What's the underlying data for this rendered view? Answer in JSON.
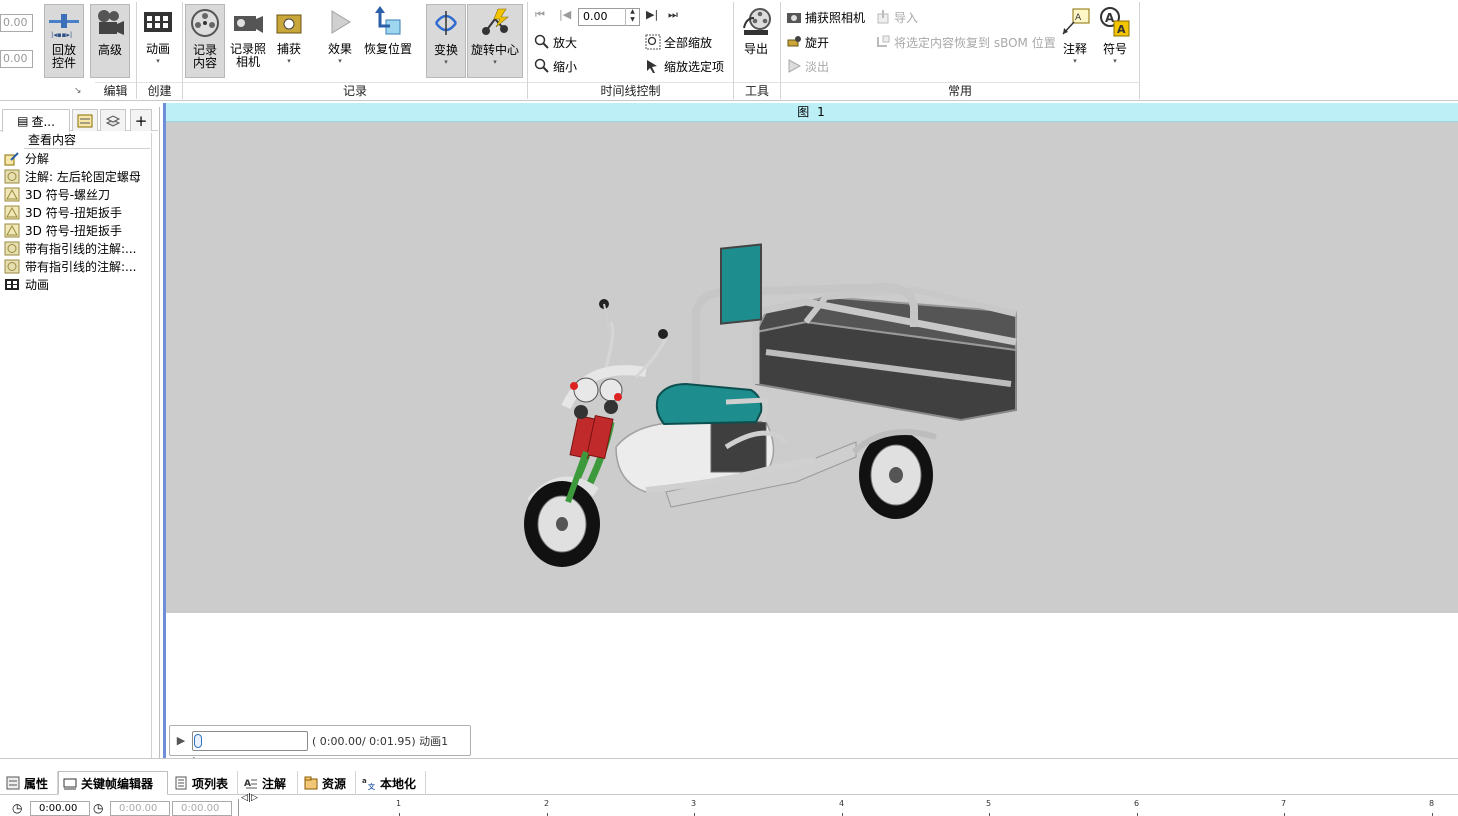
{
  "ribbon": {
    "left_inputs": [
      "0.00",
      "0.00"
    ],
    "groups": [
      {
        "label": "编辑"
      },
      {
        "label": "创建"
      },
      {
        "label": "记录"
      },
      {
        "label": "时间线控制"
      },
      {
        "label": "工具"
      },
      {
        "label": "常用"
      }
    ],
    "buttons": {
      "playback_line1": "回放",
      "playback_line2": "控件",
      "advanced": "高级",
      "animation": "动画",
      "record_content_line1": "记录",
      "record_content_line2": "内容",
      "record_camera_line1": "记录照",
      "record_camera_line2": "相机",
      "capture": "捕获",
      "effects": "效果",
      "restore_position": "恢复位置",
      "transform": "变换",
      "rotation_center": "旋转中心",
      "zoom_in": "放大",
      "zoom_out": "缩小",
      "zoom_all": "全部缩放",
      "zoom_selected": "缩放选定项",
      "export": "导出",
      "capture_camera": "捕获照相机",
      "rotate": "旋开",
      "fade_out": "淡出",
      "import": "导入",
      "restore_to_sbom": "将选定内容恢复到 sBOM 位置",
      "annotation": "注释",
      "symbol": "符号"
    },
    "time_value": "0.00",
    "dropdown_glyph": "▾"
  },
  "left_panel": {
    "tabs": [
      "查...",
      "",
      "",
      "+"
    ],
    "header": "查看内容",
    "items": [
      {
        "label": "分解",
        "icon": "explode-icon"
      },
      {
        "label": "注解: 左后轮固定螺母",
        "icon": "note-icon"
      },
      {
        "label": "3D 符号-螺丝刀",
        "icon": "symbol-icon"
      },
      {
        "label": "3D 符号-扭矩扳手",
        "icon": "symbol-icon"
      },
      {
        "label": "3D 符号-扭矩扳手",
        "icon": "symbol-icon"
      },
      {
        "label": "带有指引线的注解:...",
        "icon": "note-icon"
      },
      {
        "label": "带有指引线的注解:...",
        "icon": "note-icon"
      },
      {
        "label": "动画",
        "icon": "animation-icon"
      }
    ]
  },
  "viewport": {
    "title": "图 1",
    "scene_bg": "#cccccc",
    "player": {
      "time": "( 0:00.00/  0:01.95) 动画1",
      "progress": 0
    }
  },
  "bottom": {
    "tabs": [
      "属性",
      "关键帧编辑器",
      "项列表",
      "注解",
      "资源",
      "本地化"
    ],
    "active_tab": "关键帧编辑器",
    "time_fields": [
      "0:00.00",
      "0:00.00",
      "0:00.00"
    ],
    "ruler_labels": [
      "1",
      "2",
      "3",
      "4",
      "5",
      "6",
      "7",
      "8"
    ]
  },
  "colors": {
    "accent": "#6e8fd8",
    "title_bar": "#bdeff7",
    "seat": "#1e8d8d",
    "frame": "#b8b8b8"
  }
}
